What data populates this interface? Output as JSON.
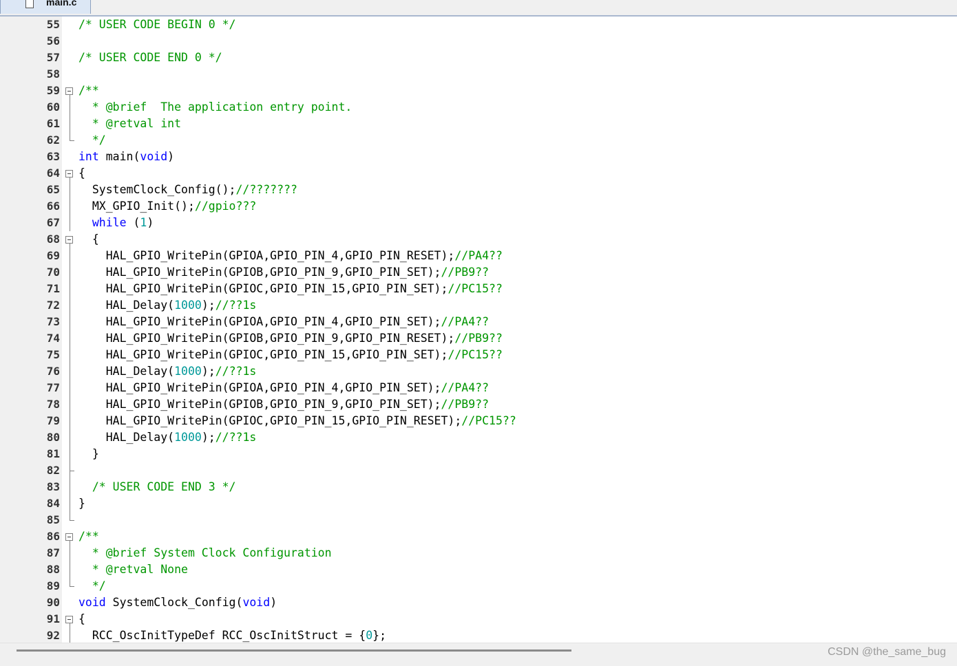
{
  "tab": {
    "filename": "main.c",
    "icon": "file-icon"
  },
  "colors": {
    "comment": "#009600",
    "keyword": "#0000ff",
    "number": "#009999",
    "text": "#000000",
    "gutter": "#f0f0f0"
  },
  "lines": [
    {
      "n": "55",
      "fold": "",
      "tokens": [
        {
          "t": "/* USER CODE BEGIN 0 */",
          "c": "comment"
        }
      ]
    },
    {
      "n": "56",
      "fold": "",
      "tokens": []
    },
    {
      "n": "57",
      "fold": "",
      "tokens": [
        {
          "t": "/* USER CODE END 0 */",
          "c": "comment"
        }
      ]
    },
    {
      "n": "58",
      "fold": "",
      "tokens": []
    },
    {
      "n": "59",
      "fold": "start",
      "tokens": [
        {
          "t": "/**",
          "c": "comment"
        }
      ]
    },
    {
      "n": "60",
      "fold": "mid",
      "tokens": [
        {
          "t": "  * @brief  The application entry point.",
          "c": "comment"
        }
      ]
    },
    {
      "n": "61",
      "fold": "mid",
      "tokens": [
        {
          "t": "  * @retval int",
          "c": "comment"
        }
      ]
    },
    {
      "n": "62",
      "fold": "end",
      "tokens": [
        {
          "t": "  */",
          "c": "comment"
        }
      ]
    },
    {
      "n": "63",
      "fold": "",
      "tokens": [
        {
          "t": "int",
          "c": "keyword"
        },
        {
          "t": " main(",
          "c": "plain"
        },
        {
          "t": "void",
          "c": "keyword"
        },
        {
          "t": ")",
          "c": "plain"
        }
      ]
    },
    {
      "n": "64",
      "fold": "start",
      "tokens": [
        {
          "t": "{",
          "c": "plain"
        }
      ]
    },
    {
      "n": "65",
      "fold": "mid",
      "tokens": [
        {
          "t": "  SystemClock_Config();",
          "c": "plain"
        },
        {
          "t": "//???????",
          "c": "comment"
        }
      ]
    },
    {
      "n": "66",
      "fold": "mid",
      "tokens": [
        {
          "t": "  MX_GPIO_Init();",
          "c": "plain"
        },
        {
          "t": "//gpio???",
          "c": "comment"
        }
      ]
    },
    {
      "n": "67",
      "fold": "mid",
      "tokens": [
        {
          "t": "  ",
          "c": "plain"
        },
        {
          "t": "while",
          "c": "keyword"
        },
        {
          "t": " (",
          "c": "plain"
        },
        {
          "t": "1",
          "c": "number"
        },
        {
          "t": ")",
          "c": "plain"
        }
      ]
    },
    {
      "n": "68",
      "fold": "start",
      "tokens": [
        {
          "t": "  {",
          "c": "plain"
        }
      ]
    },
    {
      "n": "69",
      "fold": "mid",
      "tokens": [
        {
          "t": "    HAL_GPIO_WritePin(GPIOA,GPIO_PIN_4,GPIO_PIN_RESET);",
          "c": "plain"
        },
        {
          "t": "//PA4??",
          "c": "comment"
        }
      ]
    },
    {
      "n": "70",
      "fold": "mid",
      "tokens": [
        {
          "t": "    HAL_GPIO_WritePin(GPIOB,GPIO_PIN_9,GPIO_PIN_SET);",
          "c": "plain"
        },
        {
          "t": "//PB9??",
          "c": "comment"
        }
      ]
    },
    {
      "n": "71",
      "fold": "mid",
      "tokens": [
        {
          "t": "    HAL_GPIO_WritePin(GPIOC,GPIO_PIN_15,GPIO_PIN_SET);",
          "c": "plain"
        },
        {
          "t": "//PC15??",
          "c": "comment"
        }
      ]
    },
    {
      "n": "72",
      "fold": "mid",
      "tokens": [
        {
          "t": "    HAL_Delay(",
          "c": "plain"
        },
        {
          "t": "1000",
          "c": "number"
        },
        {
          "t": ");",
          "c": "plain"
        },
        {
          "t": "//??1s",
          "c": "comment"
        }
      ]
    },
    {
      "n": "73",
      "fold": "mid",
      "tokens": [
        {
          "t": "    HAL_GPIO_WritePin(GPIOA,GPIO_PIN_4,GPIO_PIN_SET);",
          "c": "plain"
        },
        {
          "t": "//PA4??",
          "c": "comment"
        }
      ]
    },
    {
      "n": "74",
      "fold": "mid",
      "tokens": [
        {
          "t": "    HAL_GPIO_WritePin(GPIOB,GPIO_PIN_9,GPIO_PIN_RESET);",
          "c": "plain"
        },
        {
          "t": "//PB9??",
          "c": "comment"
        }
      ]
    },
    {
      "n": "75",
      "fold": "mid",
      "tokens": [
        {
          "t": "    HAL_GPIO_WritePin(GPIOC,GPIO_PIN_15,GPIO_PIN_SET);",
          "c": "plain"
        },
        {
          "t": "//PC15??",
          "c": "comment"
        }
      ]
    },
    {
      "n": "76",
      "fold": "mid",
      "tokens": [
        {
          "t": "    HAL_Delay(",
          "c": "plain"
        },
        {
          "t": "1000",
          "c": "number"
        },
        {
          "t": ");",
          "c": "plain"
        },
        {
          "t": "//??1s",
          "c": "comment"
        }
      ]
    },
    {
      "n": "77",
      "fold": "mid",
      "tokens": [
        {
          "t": "    HAL_GPIO_WritePin(GPIOA,GPIO_PIN_4,GPIO_PIN_SET);",
          "c": "plain"
        },
        {
          "t": "//PA4??",
          "c": "comment"
        }
      ]
    },
    {
      "n": "78",
      "fold": "mid",
      "tokens": [
        {
          "t": "    HAL_GPIO_WritePin(GPIOB,GPIO_PIN_9,GPIO_PIN_SET);",
          "c": "plain"
        },
        {
          "t": "//PB9??",
          "c": "comment"
        }
      ]
    },
    {
      "n": "79",
      "fold": "mid",
      "tokens": [
        {
          "t": "    HAL_GPIO_WritePin(GPIOC,GPIO_PIN_15,GPIO_PIN_RESET);",
          "c": "plain"
        },
        {
          "t": "//PC15??",
          "c": "comment"
        }
      ]
    },
    {
      "n": "80",
      "fold": "mid",
      "tokens": [
        {
          "t": "    HAL_Delay(",
          "c": "plain"
        },
        {
          "t": "1000",
          "c": "number"
        },
        {
          "t": ");",
          "c": "plain"
        },
        {
          "t": "//??1s",
          "c": "comment"
        }
      ]
    },
    {
      "n": "81",
      "fold": "mid",
      "tokens": [
        {
          "t": "  }",
          "c": "plain"
        }
      ]
    },
    {
      "n": "82",
      "fold": "tick",
      "tokens": []
    },
    {
      "n": "83",
      "fold": "mid",
      "tokens": [
        {
          "t": "  /* USER CODE END 3 */",
          "c": "comment"
        }
      ]
    },
    {
      "n": "84",
      "fold": "mid",
      "tokens": [
        {
          "t": "}",
          "c": "plain"
        }
      ]
    },
    {
      "n": "85",
      "fold": "end",
      "tokens": []
    },
    {
      "n": "86",
      "fold": "start",
      "tokens": [
        {
          "t": "/**",
          "c": "comment"
        }
      ]
    },
    {
      "n": "87",
      "fold": "mid",
      "tokens": [
        {
          "t": "  * @brief System Clock Configuration",
          "c": "comment"
        }
      ]
    },
    {
      "n": "88",
      "fold": "mid",
      "tokens": [
        {
          "t": "  * @retval None",
          "c": "comment"
        }
      ]
    },
    {
      "n": "89",
      "fold": "end",
      "tokens": [
        {
          "t": "  */",
          "c": "comment"
        }
      ]
    },
    {
      "n": "90",
      "fold": "",
      "tokens": [
        {
          "t": "void",
          "c": "keyword"
        },
        {
          "t": " SystemClock_Config(",
          "c": "plain"
        },
        {
          "t": "void",
          "c": "keyword"
        },
        {
          "t": ")",
          "c": "plain"
        }
      ]
    },
    {
      "n": "91",
      "fold": "start",
      "tokens": [
        {
          "t": "{",
          "c": "plain"
        }
      ]
    },
    {
      "n": "92",
      "fold": "mid",
      "tokens": [
        {
          "t": "  RCC_OscInitTypeDef RCC_OscInitStruct = {",
          "c": "plain"
        },
        {
          "t": "0",
          "c": "number"
        },
        {
          "t": "};",
          "c": "plain"
        }
      ]
    }
  ],
  "watermark": "CSDN @the_same_bug"
}
